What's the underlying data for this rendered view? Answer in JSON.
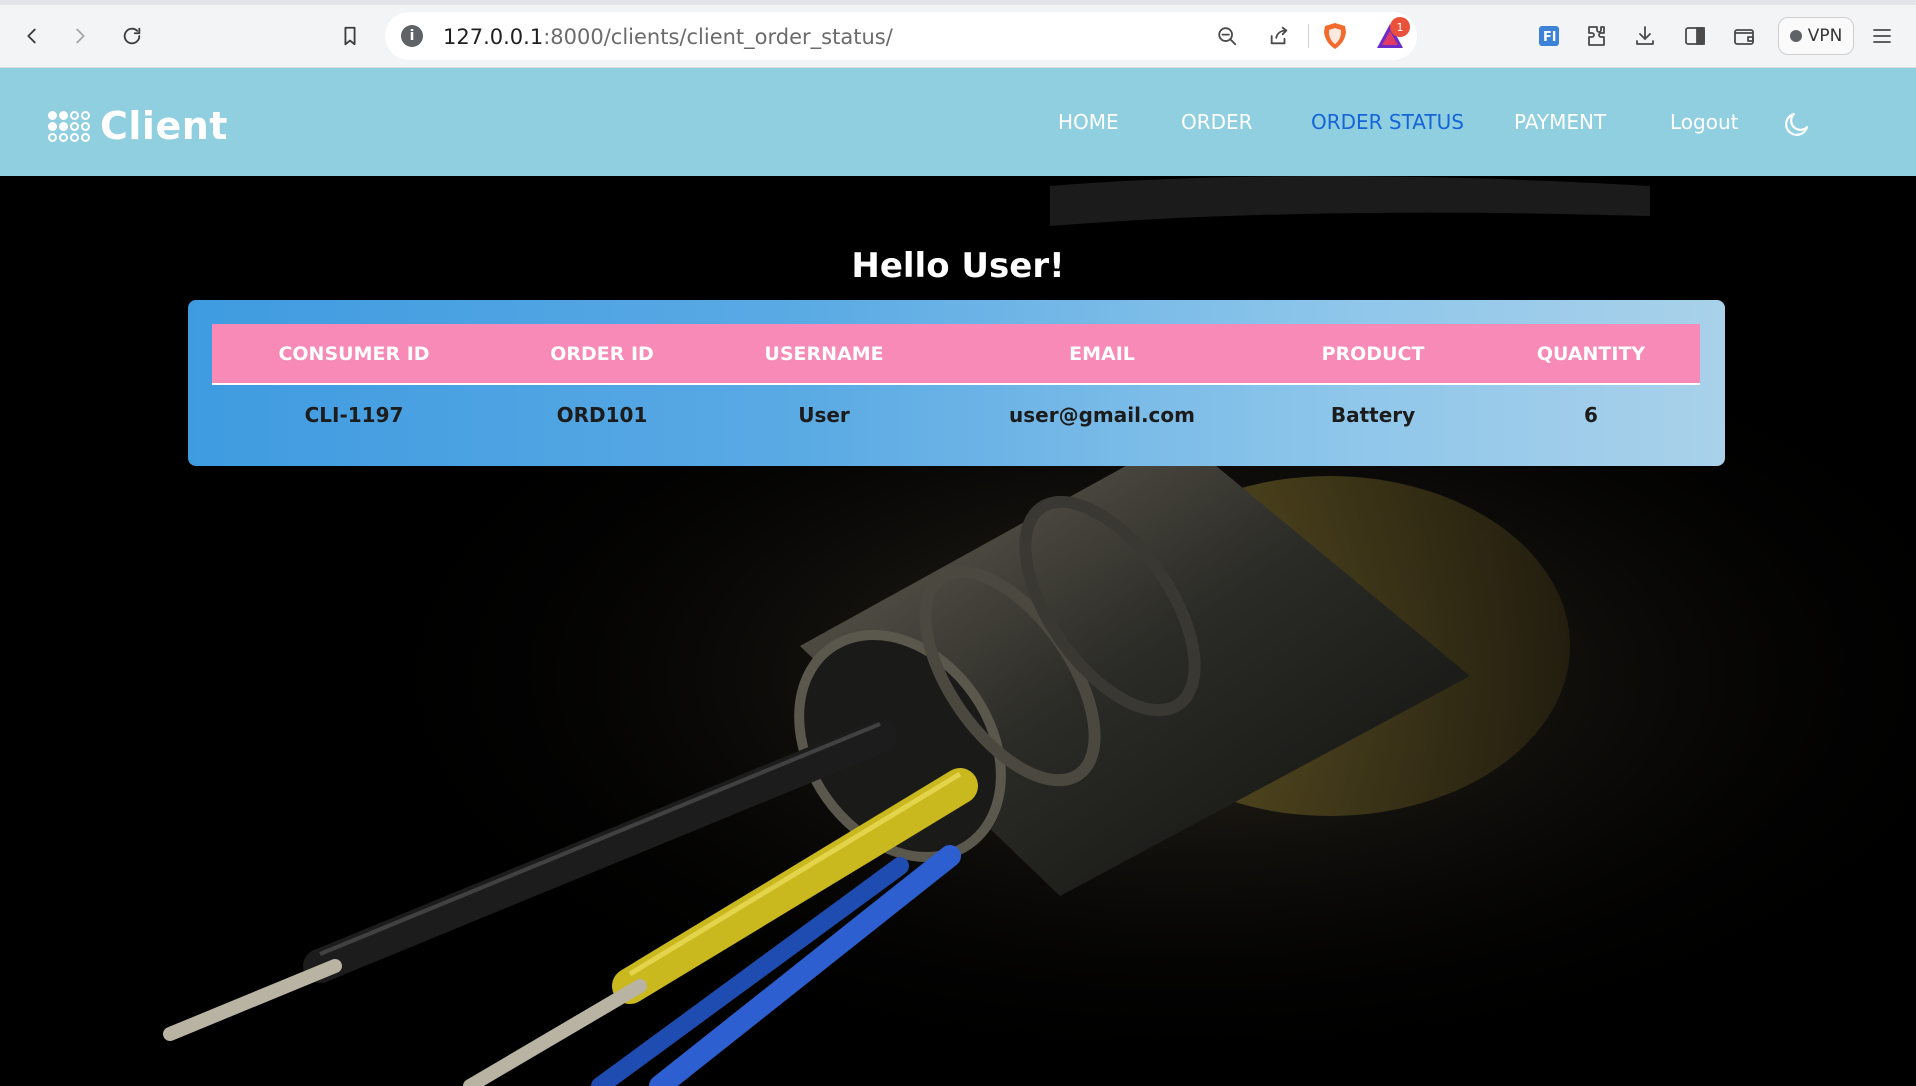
{
  "browser": {
    "url_host": "127.0.0.1",
    "url_path": ":8000/clients/client_order_status/",
    "rewards_count": "1",
    "vpn_label": "VPN"
  },
  "site": {
    "logo_text": "Client",
    "nav": {
      "home": "HOME",
      "order": "ORDER",
      "order_status": "ORDER STATUS",
      "payment": "PAYMENT",
      "logout": "Logout"
    },
    "active_nav": "order_status",
    "colors": {
      "header_bg": "#90cfe0",
      "active_link": "#1565d8",
      "table_header": "#f78ab6",
      "card_gradient_start": "#3f9be0",
      "card_gradient_end": "#a9d1ea"
    }
  },
  "main": {
    "greeting": "Hello User!",
    "table": {
      "headers": [
        "CONSUMER ID",
        "ORDER ID",
        "USERNAME",
        "EMAIL",
        "PRODUCT",
        "QUANTITY"
      ],
      "rows": [
        [
          "CLI-1197",
          "ORD101",
          "User",
          "user@gmail.com",
          "Battery",
          "6"
        ]
      ]
    }
  },
  "icons": {
    "back": "back-arrow-icon",
    "forward": "forward-arrow-icon",
    "reload": "reload-icon",
    "bookmark": "bookmark-icon",
    "site_info": "info-icon",
    "zoom": "zoom-out-icon",
    "share": "share-icon",
    "shield": "brave-shield-icon",
    "rewards": "brave-rewards-icon",
    "translate": "translate-icon",
    "extensions": "extensions-icon",
    "downloads": "download-icon",
    "sidebar": "sidebar-icon",
    "wallet": "wallet-icon",
    "menu": "hamburger-menu-icon",
    "theme": "moon-icon"
  }
}
